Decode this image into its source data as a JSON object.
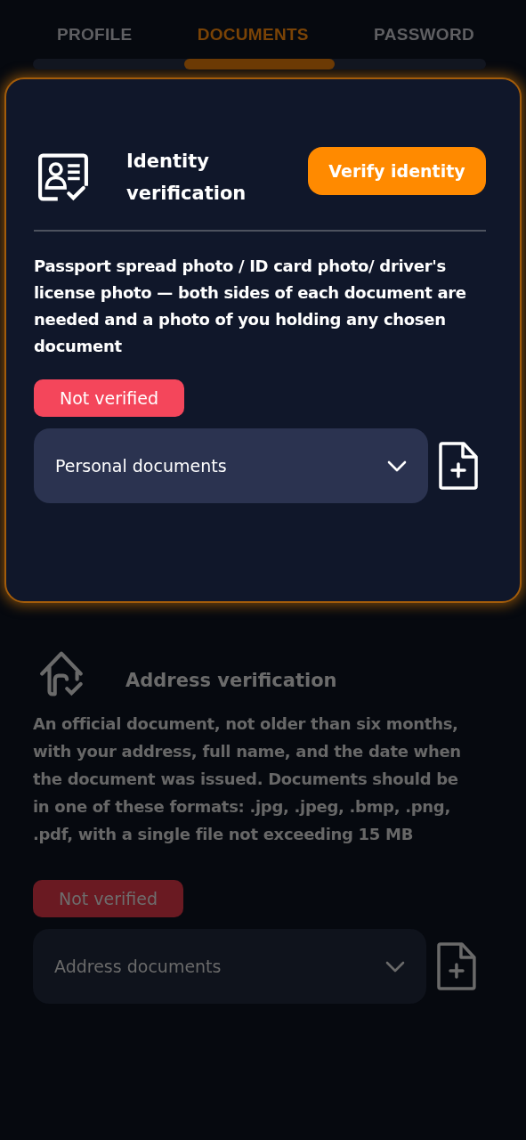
{
  "tabs": [
    {
      "label": "PROFILE",
      "selected": false
    },
    {
      "label": "DOCUMENTS",
      "selected": true
    },
    {
      "label": "PASSWORD",
      "selected": false
    }
  ],
  "sections": [
    {
      "kind": "identity",
      "highlighted": true,
      "title": "Identity verification",
      "button": "Verify identity",
      "description": "Passport spread photo / ID card photo/ driver's license photo — both sides of each document are needed and a photo of you holding any chosen document",
      "status": "Not verified",
      "dropdown": "Personal documents"
    },
    {
      "kind": "address",
      "highlighted": false,
      "title": "Address verification",
      "description": "An official document, not older than six months, with your address, full name, and the date when the document was issued. Documents should be in one of these formats: .jpg, .jpeg, .bmp, .png, .pdf, with a single file not exceeding 15 MB",
      "status": "Not verified",
      "dropdown": "Address documents"
    }
  ]
}
